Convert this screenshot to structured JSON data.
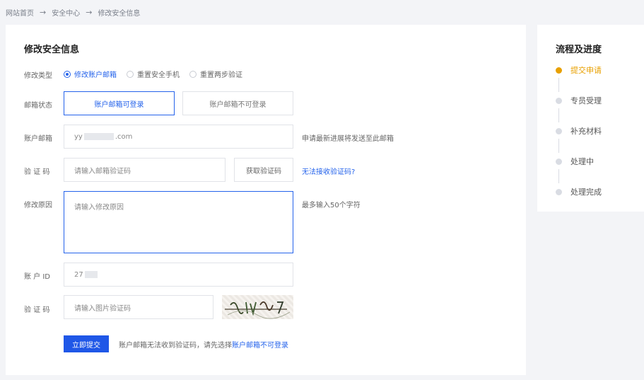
{
  "breadcrumb": {
    "items": [
      "网站首页",
      "安全中心",
      "修改安全信息"
    ],
    "separator": "→"
  },
  "form": {
    "title": "修改安全信息",
    "type": {
      "label": "修改类型",
      "options": [
        "修改账户邮箱",
        "重置安全手机",
        "重置两步验证"
      ],
      "selected": "修改账户邮箱"
    },
    "mail_status": {
      "label": "邮箱状态",
      "options": [
        "账户邮箱可登录",
        "账户邮箱不可登录"
      ],
      "selected": "账户邮箱可登录"
    },
    "email": {
      "label": "账户邮箱",
      "value_prefix": "yy",
      "value_suffix": ".com",
      "hint": "申请最新进展将发送至此邮箱"
    },
    "verify_code": {
      "label": "验 证 码",
      "placeholder": "请输入邮箱验证码",
      "button": "获取验证码",
      "link": "无法接收验证码?"
    },
    "reason": {
      "label": "修改原因",
      "placeholder": "请输入修改原因",
      "hint": "最多输入50个字符"
    },
    "account_id": {
      "label": "账 户 ID",
      "value_prefix": "27"
    },
    "captcha": {
      "label": "验 证 码",
      "placeholder": "请输入图片验证码"
    },
    "submit": {
      "label": "立即提交",
      "note": "账户邮箱无法收到验证码，请先选择",
      "note_link": "账户邮箱不可登录"
    }
  },
  "progress": {
    "title": "流程及进度",
    "steps": [
      "提交申请",
      "专员受理",
      "补充材料",
      "处理中",
      "处理完成"
    ],
    "current": "提交申请"
  },
  "colors": {
    "accent": "#2563eb",
    "current_step": "#e8a000",
    "background": "#f3f4f7"
  }
}
